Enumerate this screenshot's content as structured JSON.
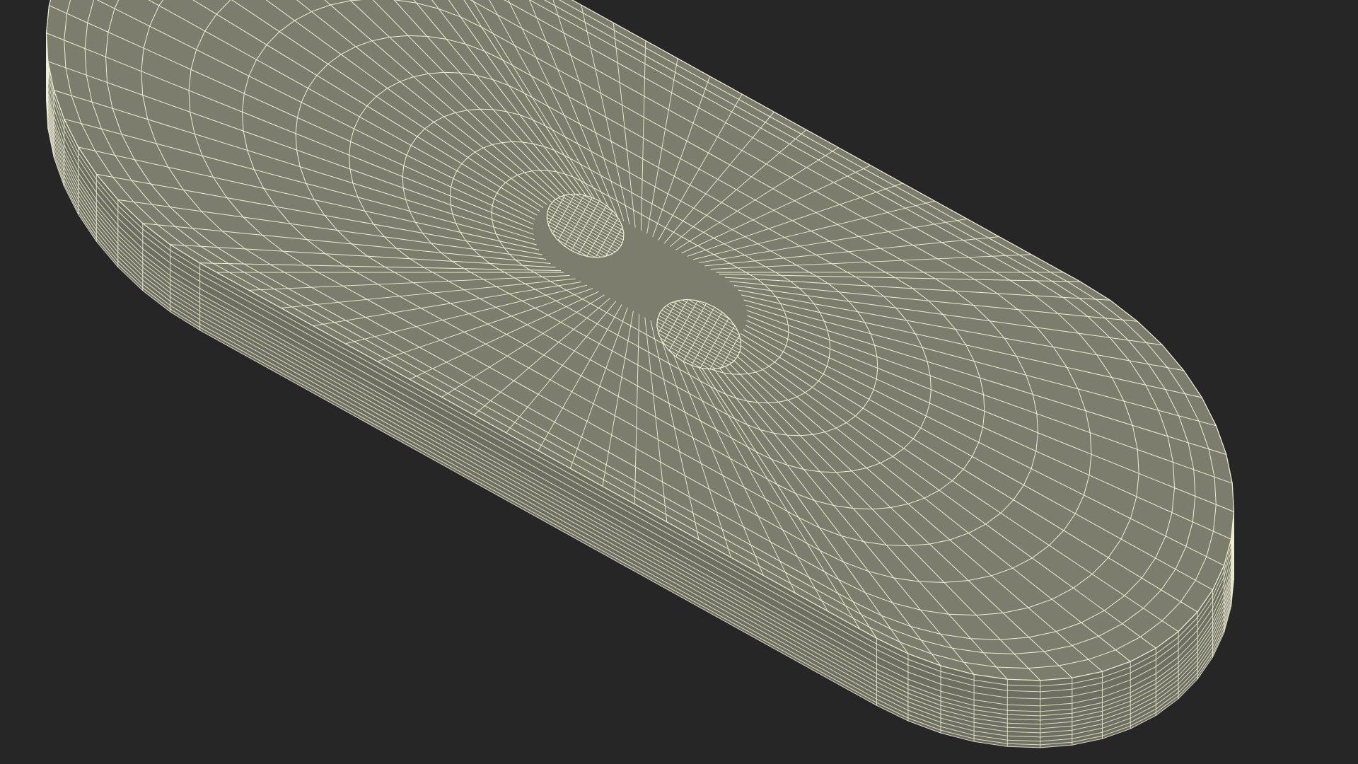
{
  "scene": {
    "subject": "wireframe-pill-shaped-object",
    "colors": {
      "background": "#262626",
      "shell_fill": "#797A6A",
      "shell_fill_dark": "#6E6F60",
      "top_fill": "#7C7D6D",
      "wire": "#EFEFD7"
    },
    "icons": [
      "button-hole-icon",
      "top-dimple-icon"
    ]
  }
}
